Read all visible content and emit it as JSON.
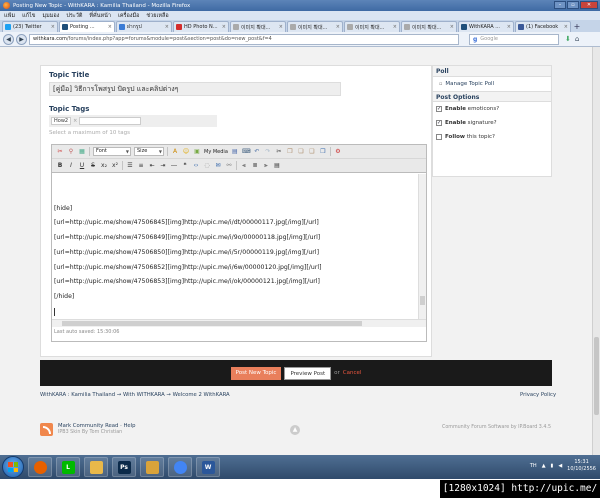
{
  "window": {
    "title": "Posting New Topic - WithKARA : Kamilia Thailand - Mozilla Firefox"
  },
  "menu": [
    "แฟ้ม",
    "แก้ไข",
    "มุมมอง",
    "ประวัติ",
    "ที่คั่นหน้า",
    "เครื่องมือ",
    "ช่วยเหลือ"
  ],
  "tabs": [
    {
      "label": "(23) Twitter",
      "color": "#1da1f2"
    },
    {
      "label": "Posting ...",
      "color": "#1f4f7a",
      "active": true
    },
    {
      "label": "ฝากรูป",
      "color": "#3a7bd5"
    },
    {
      "label": "HD Photo N...",
      "color": "#d42d2d"
    },
    {
      "label": "이미지 확대...",
      "color": "#aaaaaa"
    },
    {
      "label": "이미지 확대...",
      "color": "#aaaaaa"
    },
    {
      "label": "이미지 확대...",
      "color": "#aaaaaa"
    },
    {
      "label": "이미지 확대...",
      "color": "#aaaaaa"
    },
    {
      "label": "WithKARA ...",
      "color": "#1f4f7a"
    },
    {
      "label": "(1) Facebook",
      "color": "#3b5998"
    }
  ],
  "nav": {
    "url_domain": "withkara.com",
    "url_path": "/forums/index.php?app=forums&module=post&section=post&do=new_post&f=4",
    "search_placeholder": "Google"
  },
  "form": {
    "topic_title_label": "Topic Title",
    "topic_title_value": "[คู่มือ] วิธีการโพสรูป ปัดรูป และคลิปต่างๆ",
    "topic_tags_label": "Topic Tags",
    "tag_chip": "How2",
    "tags_hint": "Select a maximum of 10 tags"
  },
  "editor": {
    "font_select": "Font",
    "size_select": "Size",
    "my_media": "My Media",
    "lines": [
      "[hide]",
      " [url=http://upic.me/show/47506845][img]http://upic.me/i/dt/00000117.jpg[/img][/url]",
      "[url=http://upic.me/show/47506849][img]http://upic.me/i/9o/00000118.jpg[/img][/url]",
      "[url=http://upic.me/show/47506850][img]http://upic.me/i/5r/00000119.jpg[/img][/url]",
      "[url=http://upic.me/show/47506852][img]http://upic.me/i/6w/00000120.jpg[/img][/url]",
      "[url=http://upic.me/show/47506853][img]http://upic.me/i/ok/00000121.jpg[/img][/url]",
      "[/hide]"
    ],
    "autosave": "Last auto saved: 15:30:06"
  },
  "sidebar": {
    "poll_title": "Poll",
    "manage_poll": "Manage Topic Poll",
    "options_title": "Post Options",
    "options": [
      {
        "bold": "Enable",
        "rest": " emoticons?",
        "checked": "✓"
      },
      {
        "bold": "Enable",
        "rest": " signature?",
        "checked": "✓"
      },
      {
        "bold": "Follow",
        "rest": " this topic?",
        "checked": ""
      }
    ]
  },
  "submit": {
    "post_label": "Post New Topic",
    "preview_label": "Preview Post",
    "or_label": "or",
    "cancel_label": "Cancel"
  },
  "breadcrumb": "WithKARA : Kamilia Thailand  →  With WITHKARA  →  Welcome 2 WithKARA",
  "privacy": "Privacy Policy",
  "footer": {
    "left": "Mark Community Read · Help",
    "skin": "IPB3 Skin By Tom Christian",
    "right": "Community Forum Software by IP.Board 3.4.5"
  },
  "taskbar": {
    "apps": [
      {
        "name": "firefox",
        "color": "#e66000",
        "glyph": ""
      },
      {
        "name": "line",
        "color": "#00b900",
        "glyph": "L"
      },
      {
        "name": "folder",
        "color": "#e8b84a",
        "glyph": ""
      },
      {
        "name": "photoshop",
        "color": "#0b2a4a",
        "glyph": "Ps"
      },
      {
        "name": "explorer",
        "color": "#d9a33a",
        "glyph": ""
      },
      {
        "name": "chrome",
        "color": "#4285f4",
        "glyph": ""
      },
      {
        "name": "word",
        "color": "#2b579a",
        "glyph": "W"
      }
    ],
    "lang": "TH",
    "time": "15:31",
    "date": "10/10/2556"
  },
  "overlay": "[1280x1024]  http://upic.me/"
}
